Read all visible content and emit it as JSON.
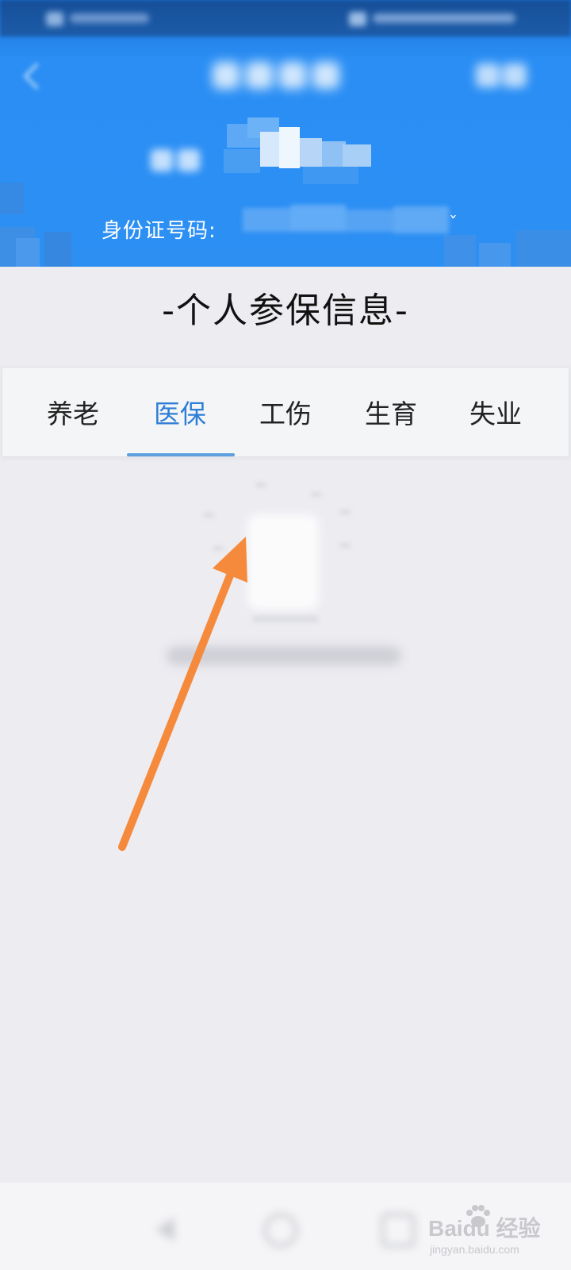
{
  "header": {
    "id_label": "身份证号码:",
    "id_tail": "ˇ"
  },
  "section": {
    "title": "-个人参保信息-"
  },
  "tabs": [
    {
      "label": "养老",
      "active": false
    },
    {
      "label": "医保",
      "active": true
    },
    {
      "label": "工伤",
      "active": false
    },
    {
      "label": "生育",
      "active": false
    },
    {
      "label": "失业",
      "active": false
    }
  ],
  "colors": {
    "header_blue": "#2b8ff5",
    "tab_active": "#2d7ed6",
    "arrow_orange": "#f58a3c"
  },
  "watermark": {
    "main": "Baidu 经验",
    "sub": "jingyan.baidu.com"
  },
  "icons": {
    "back": "back-arrow-icon",
    "home": "home-circle-icon",
    "recent": "recent-apps-icon",
    "empty": "empty-state-illustration"
  }
}
